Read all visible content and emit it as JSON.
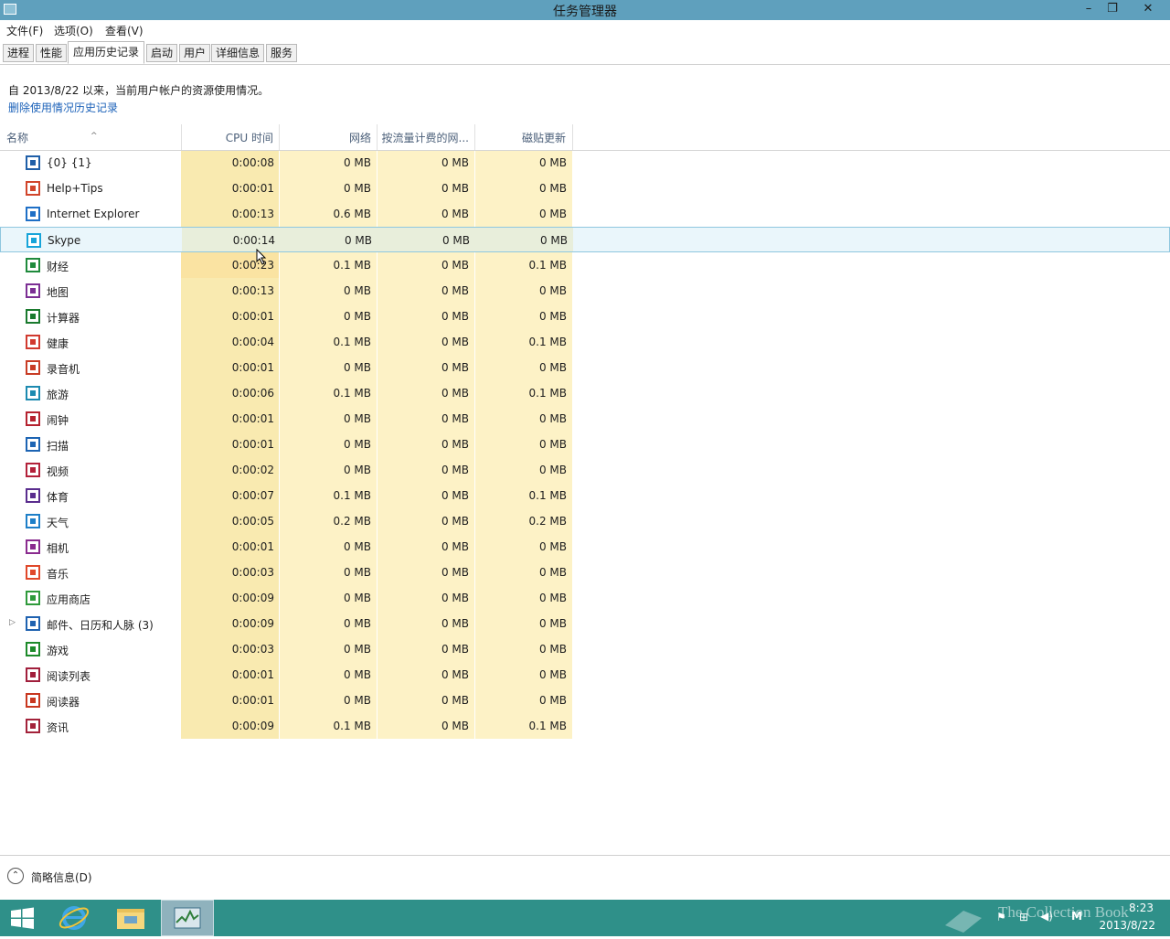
{
  "window": {
    "title": "任务管理器",
    "minimize": "–",
    "restore": "❐",
    "close": "✕"
  },
  "menu": [
    "文件(F)",
    "选项(O)",
    "查看(V)"
  ],
  "tabs": [
    "进程",
    "性能",
    "应用历史记录",
    "启动",
    "用户",
    "详细信息",
    "服务"
  ],
  "active_tab": "应用历史记录",
  "info_text": "自 2013/8/22 以来，当前用户帐户的资源使用情况。",
  "delete_link": "删除使用情况历史记录",
  "columns": {
    "name": "名称",
    "cpu": "CPU 时间",
    "network": "网络",
    "metered": "按流量计费的网...",
    "tile": "磁贴更新"
  },
  "rows": [
    {
      "name": "{0} {1}",
      "cpu": "0:00:08",
      "net": "0 MB",
      "metered": "0 MB",
      "tile": "0 MB",
      "icon": "equalizer-icon",
      "color": "#1f5fa8"
    },
    {
      "name": "Help+Tips",
      "cpu": "0:00:01",
      "net": "0 MB",
      "metered": "0 MB",
      "tile": "0 MB",
      "icon": "help-icon",
      "color": "#d1452b"
    },
    {
      "name": "Internet Explorer",
      "cpu": "0:00:13",
      "net": "0.6 MB",
      "metered": "0 MB",
      "tile": "0 MB",
      "icon": "ie-icon",
      "color": "#1e6fc6"
    },
    {
      "name": "Skype",
      "cpu": "0:00:14",
      "net": "0 MB",
      "metered": "0 MB",
      "tile": "0 MB",
      "icon": "skype-icon",
      "color": "#17a4d9"
    },
    {
      "name": "财经",
      "cpu": "0:00:23",
      "net": "0.1 MB",
      "metered": "0 MB",
      "tile": "0.1 MB",
      "icon": "finance-icon",
      "color": "#1f8a3c"
    },
    {
      "name": "地图",
      "cpu": "0:00:13",
      "net": "0 MB",
      "metered": "0 MB",
      "tile": "0 MB",
      "icon": "map-icon",
      "color": "#7c2f94"
    },
    {
      "name": "计算器",
      "cpu": "0:00:01",
      "net": "0 MB",
      "metered": "0 MB",
      "tile": "0 MB",
      "icon": "calculator-icon",
      "color": "#1a7a2e"
    },
    {
      "name": "健康",
      "cpu": "0:00:04",
      "net": "0.1 MB",
      "metered": "0 MB",
      "tile": "0.1 MB",
      "icon": "health-icon",
      "color": "#d13a2f"
    },
    {
      "name": "录音机",
      "cpu": "0:00:01",
      "net": "0 MB",
      "metered": "0 MB",
      "tile": "0 MB",
      "icon": "recorder-icon",
      "color": "#c83c25"
    },
    {
      "name": "旅游",
      "cpu": "0:00:06",
      "net": "0.1 MB",
      "metered": "0 MB",
      "tile": "0.1 MB",
      "icon": "travel-icon",
      "color": "#1c8ab0"
    },
    {
      "name": "闹钟",
      "cpu": "0:00:01",
      "net": "0 MB",
      "metered": "0 MB",
      "tile": "0 MB",
      "icon": "alarm-icon",
      "color": "#b5222f"
    },
    {
      "name": "扫描",
      "cpu": "0:00:01",
      "net": "0 MB",
      "metered": "0 MB",
      "tile": "0 MB",
      "icon": "scan-icon",
      "color": "#1d64b3"
    },
    {
      "name": "视频",
      "cpu": "0:00:02",
      "net": "0 MB",
      "metered": "0 MB",
      "tile": "0 MB",
      "icon": "video-icon",
      "color": "#b3213a"
    },
    {
      "name": "体育",
      "cpu": "0:00:07",
      "net": "0.1 MB",
      "metered": "0 MB",
      "tile": "0.1 MB",
      "icon": "sports-icon",
      "color": "#5a2d8e"
    },
    {
      "name": "天气",
      "cpu": "0:00:05",
      "net": "0.2 MB",
      "metered": "0 MB",
      "tile": "0.2 MB",
      "icon": "weather-icon",
      "color": "#1e7fc8"
    },
    {
      "name": "相机",
      "cpu": "0:00:01",
      "net": "0 MB",
      "metered": "0 MB",
      "tile": "0 MB",
      "icon": "camera-icon",
      "color": "#8a2b8f"
    },
    {
      "name": "音乐",
      "cpu": "0:00:03",
      "net": "0 MB",
      "metered": "0 MB",
      "tile": "0 MB",
      "icon": "music-icon",
      "color": "#e0482a"
    },
    {
      "name": "应用商店",
      "cpu": "0:00:09",
      "net": "0 MB",
      "metered": "0 MB",
      "tile": "0 MB",
      "icon": "store-icon",
      "color": "#2f9a3b"
    },
    {
      "name": "邮件、日历和人脉 (3)",
      "cpu": "0:00:09",
      "net": "0 MB",
      "metered": "0 MB",
      "tile": "0 MB",
      "icon": "mail-icon",
      "color": "#1f62b0",
      "expandable": true
    },
    {
      "name": "游戏",
      "cpu": "0:00:03",
      "net": "0 MB",
      "metered": "0 MB",
      "tile": "0 MB",
      "icon": "games-icon",
      "color": "#1d8a2a"
    },
    {
      "name": "阅读列表",
      "cpu": "0:00:01",
      "net": "0 MB",
      "metered": "0 MB",
      "tile": "0 MB",
      "icon": "reading-list-icon",
      "color": "#a11f3c"
    },
    {
      "name": "阅读器",
      "cpu": "0:00:01",
      "net": "0 MB",
      "metered": "0 MB",
      "tile": "0 MB",
      "icon": "reader-icon",
      "color": "#c8371f"
    },
    {
      "name": "资讯",
      "cpu": "0:00:09",
      "net": "0.1 MB",
      "metered": "0 MB",
      "tile": "0.1 MB",
      "icon": "news-icon",
      "color": "#a3223a"
    }
  ],
  "selected_row": "Skype",
  "footer": {
    "fewer_details": "简略信息(D)"
  },
  "taskbar": {
    "time": "8:23",
    "date": "2013/8/22",
    "watermark": "The Collection Book",
    "ime": "M"
  }
}
